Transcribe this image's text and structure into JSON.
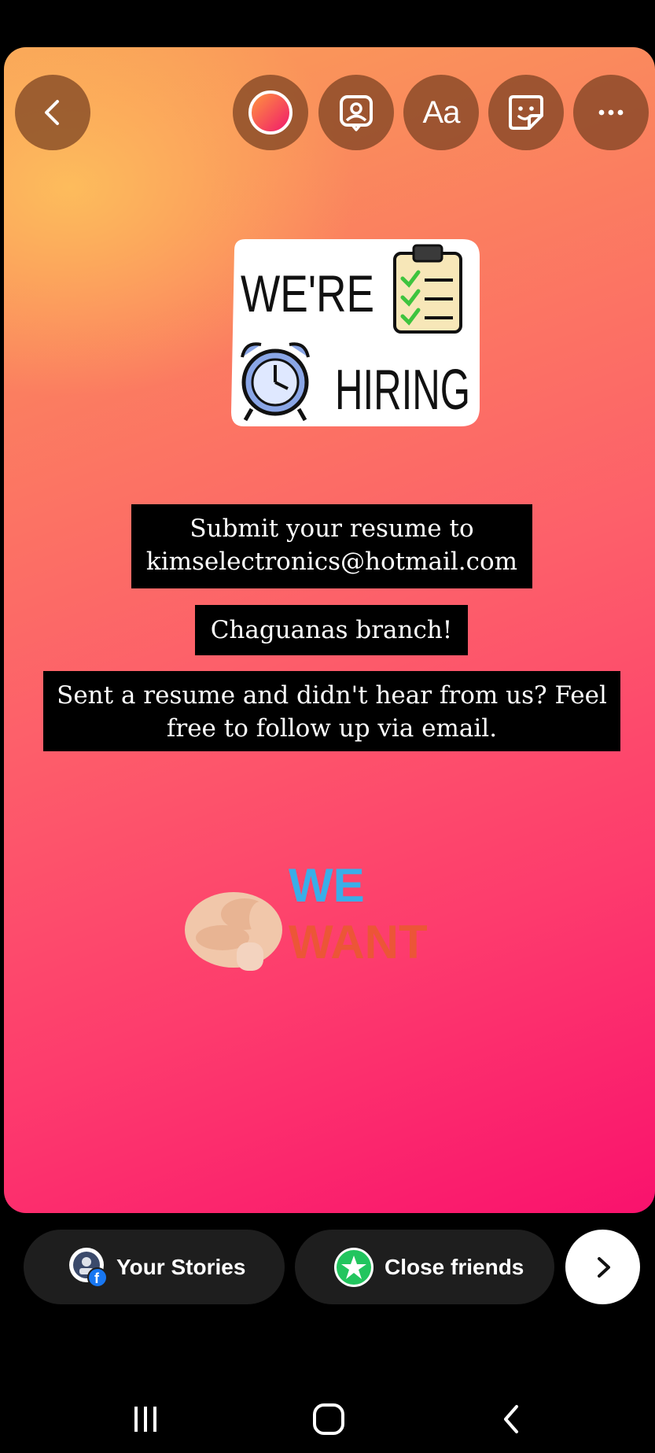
{
  "toolbar": {
    "back_icon": "chevron-left-icon",
    "draw_icon": "draw-color-icon",
    "mention_icon": "mention-icon",
    "text_label": "Aa",
    "sticker_icon": "sticker-icon",
    "more_icon": "more-icon"
  },
  "stickers": {
    "hiring": {
      "line1": "WE'RE",
      "line2": "HIRING"
    },
    "want": {
      "line1": "WE",
      "line2": "WANT"
    }
  },
  "captions": {
    "resume": {
      "line1": "Submit your resume to",
      "line2": "kimselectronics@hotmail.com"
    },
    "branch": "Chaguanas branch!",
    "followup": {
      "line1": "Sent a resume and didn't hear from us? Feel",
      "line2": "free to follow up via email."
    }
  },
  "share": {
    "your_stories": "Your Stories",
    "close_friends": "Close friends",
    "next_icon": "chevron-right-icon"
  },
  "colors": {
    "gradient_top": "#fdbe5c",
    "gradient_bottom": "#f9126d",
    "toolbar_button": "#784020",
    "caption_background": "#000000",
    "close_friends_green": "#22c55e",
    "we_blue": "#3aaee8",
    "want_orange": "#ea5a2e"
  },
  "system_nav": {
    "recents_icon": "recents-icon",
    "home_icon": "home-icon",
    "back_icon": "nav-back-icon"
  }
}
